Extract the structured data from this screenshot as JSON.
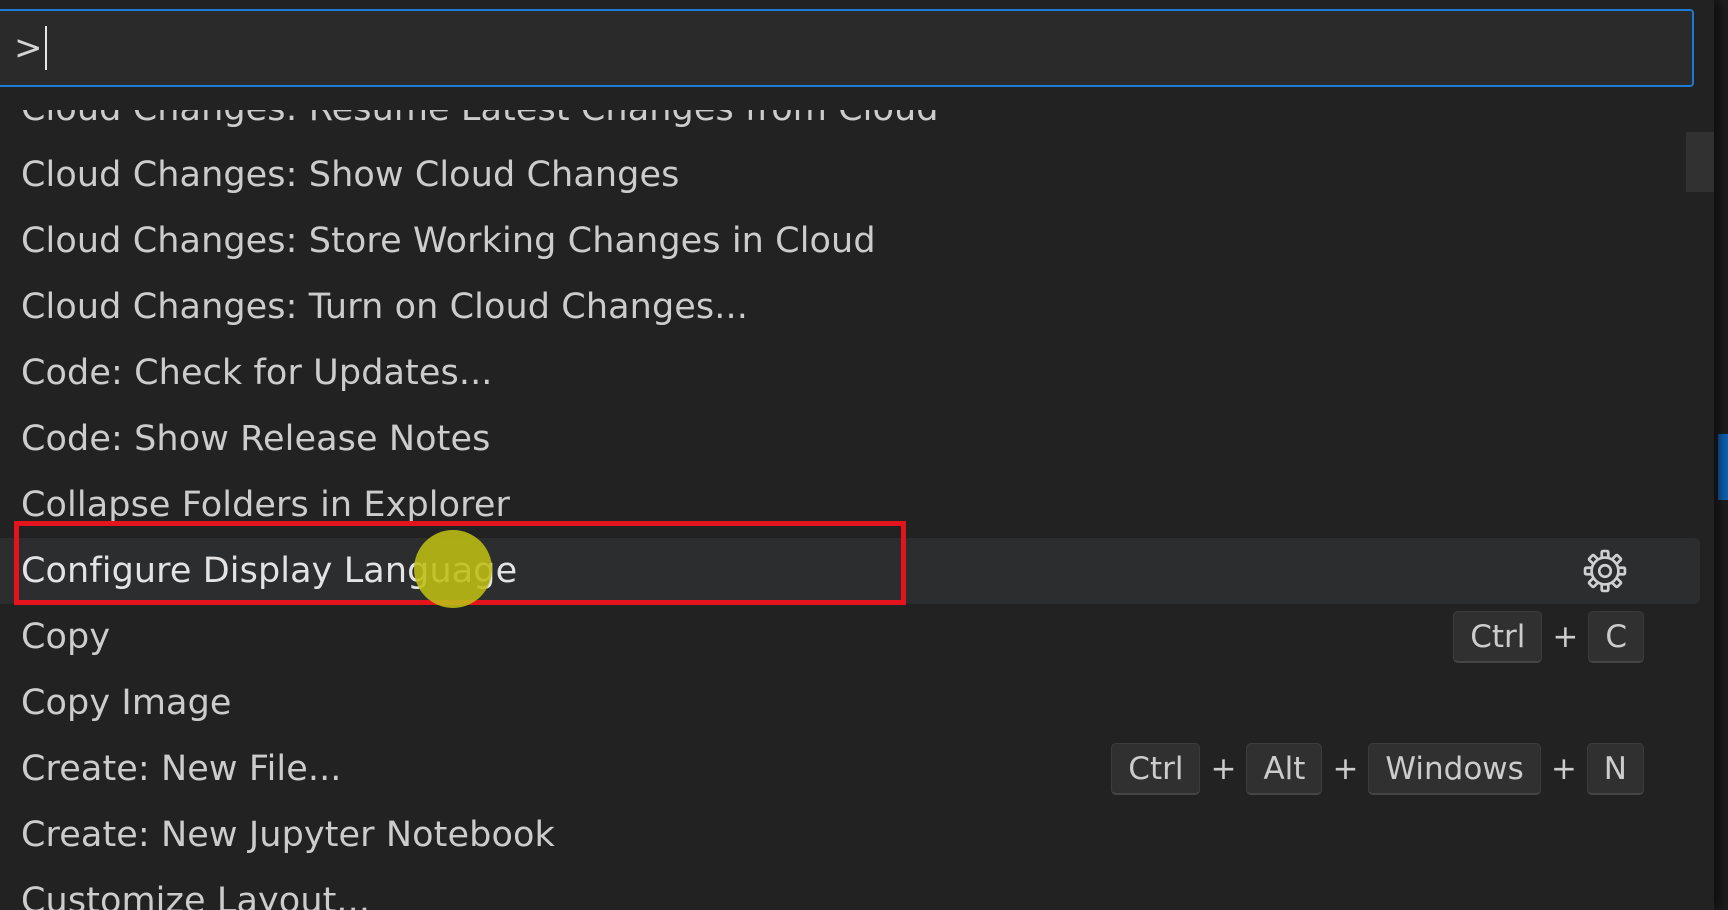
{
  "command_palette": {
    "input_value": ">",
    "items": [
      {
        "label": "Cloud Changes: Resume Latest Changes from Cloud",
        "keys": []
      },
      {
        "label": "Cloud Changes: Show Cloud Changes",
        "keys": []
      },
      {
        "label": "Cloud Changes: Store Working Changes in Cloud",
        "keys": []
      },
      {
        "label": "Cloud Changes: Turn on Cloud Changes...",
        "keys": []
      },
      {
        "label": "Code: Check for Updates...",
        "keys": []
      },
      {
        "label": "Code: Show Release Notes",
        "keys": []
      },
      {
        "label": "Collapse Folders in Explorer",
        "keys": []
      },
      {
        "label": "Configure Display Language",
        "keys": [],
        "selected": true,
        "action_icon": "gear-icon"
      },
      {
        "label": "Copy",
        "keys": [
          "Ctrl",
          "C"
        ]
      },
      {
        "label": "Copy Image",
        "keys": []
      },
      {
        "label": "Create: New File...",
        "keys": [
          "Ctrl",
          "Alt",
          "Windows",
          "N"
        ]
      },
      {
        "label": "Create: New Jupyter Notebook",
        "keys": []
      },
      {
        "label": "Customize Layout...",
        "keys": []
      }
    ],
    "key_separator": "+"
  },
  "colors": {
    "accent": "#1d7ad4",
    "highlight_box": "#e3141b",
    "cursor_marker": "#bebe14"
  }
}
